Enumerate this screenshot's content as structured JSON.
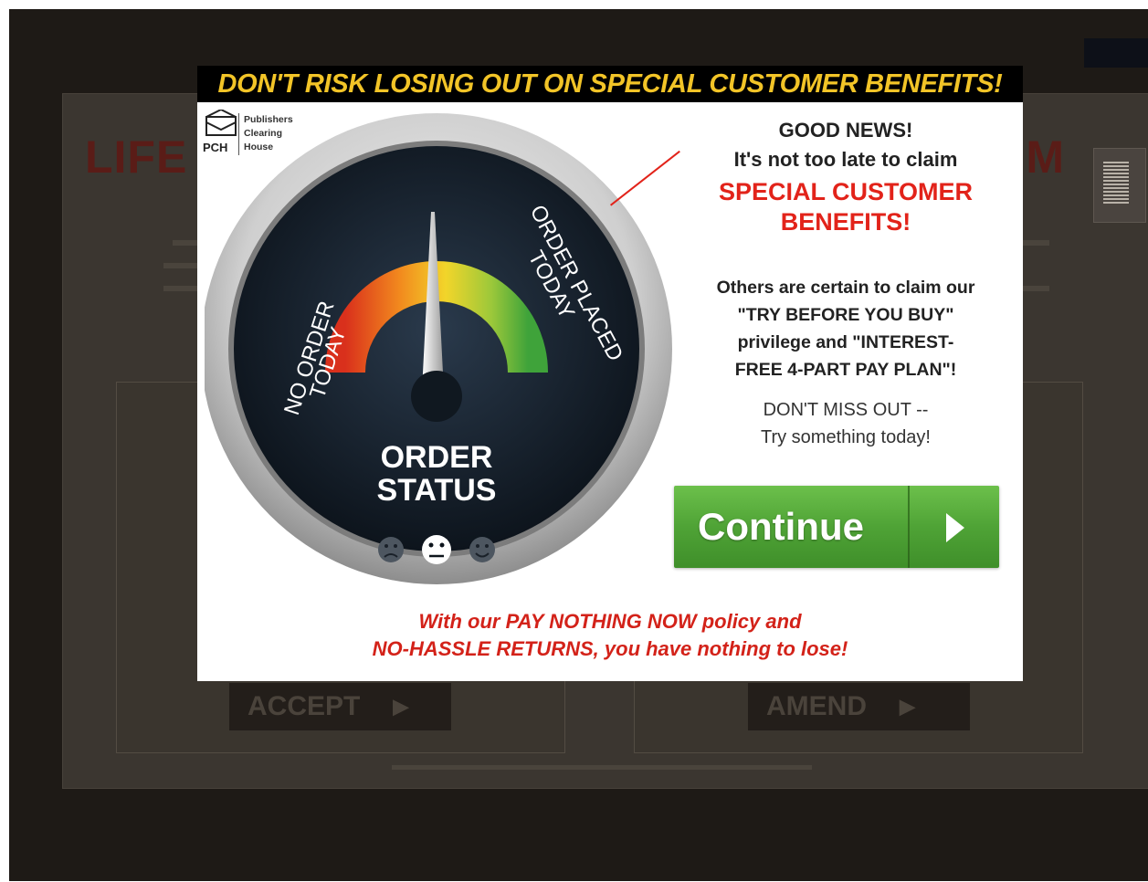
{
  "background_page": {
    "title_left": "LIFE",
    "title_right": "M",
    "accept_label": "ACCEPT",
    "amend_label": "AMEND"
  },
  "modal": {
    "header": "DON'T RISK LOSING OUT ON SPECIAL CUSTOMER BENEFITS!",
    "logo": {
      "abbr": "PCH",
      "line1": "Publishers",
      "line2": "Clearing",
      "line3": "House"
    },
    "gauge": {
      "left_label_1": "NO ORDER",
      "left_label_2": "TODAY",
      "right_label_1": "ORDER PLACED",
      "right_label_2": "TODAY",
      "center_line1": "ORDER",
      "center_line2": "STATUS",
      "needle_level": 0.5,
      "faces": [
        "sad-face",
        "neutral-face",
        "happy-face"
      ],
      "active_face": "neutral-face"
    },
    "good_news": "GOOD NEWS!",
    "not_too_late": "It's not too late to claim",
    "special_1": "SPECIAL CUSTOMER",
    "special_2": "BENEFITS!",
    "others_1": "Others are certain to claim our",
    "others_2": "\"TRY BEFORE YOU BUY\"",
    "others_3": "privilege and \"INTEREST-",
    "others_4": "FREE 4-PART PAY PLAN\"!",
    "dont_miss_1": "DON'T MISS OUT --",
    "dont_miss_2": "Try something today!",
    "continue_label": "Continue",
    "tagline_1": "With our PAY NOTHING NOW policy and",
    "tagline_2": "NO-HASSLE RETURNS, you have nothing to lose!"
  },
  "colors": {
    "header_text": "#f2c427",
    "accent_red": "#e2231a",
    "button_green": "#4fa336"
  }
}
